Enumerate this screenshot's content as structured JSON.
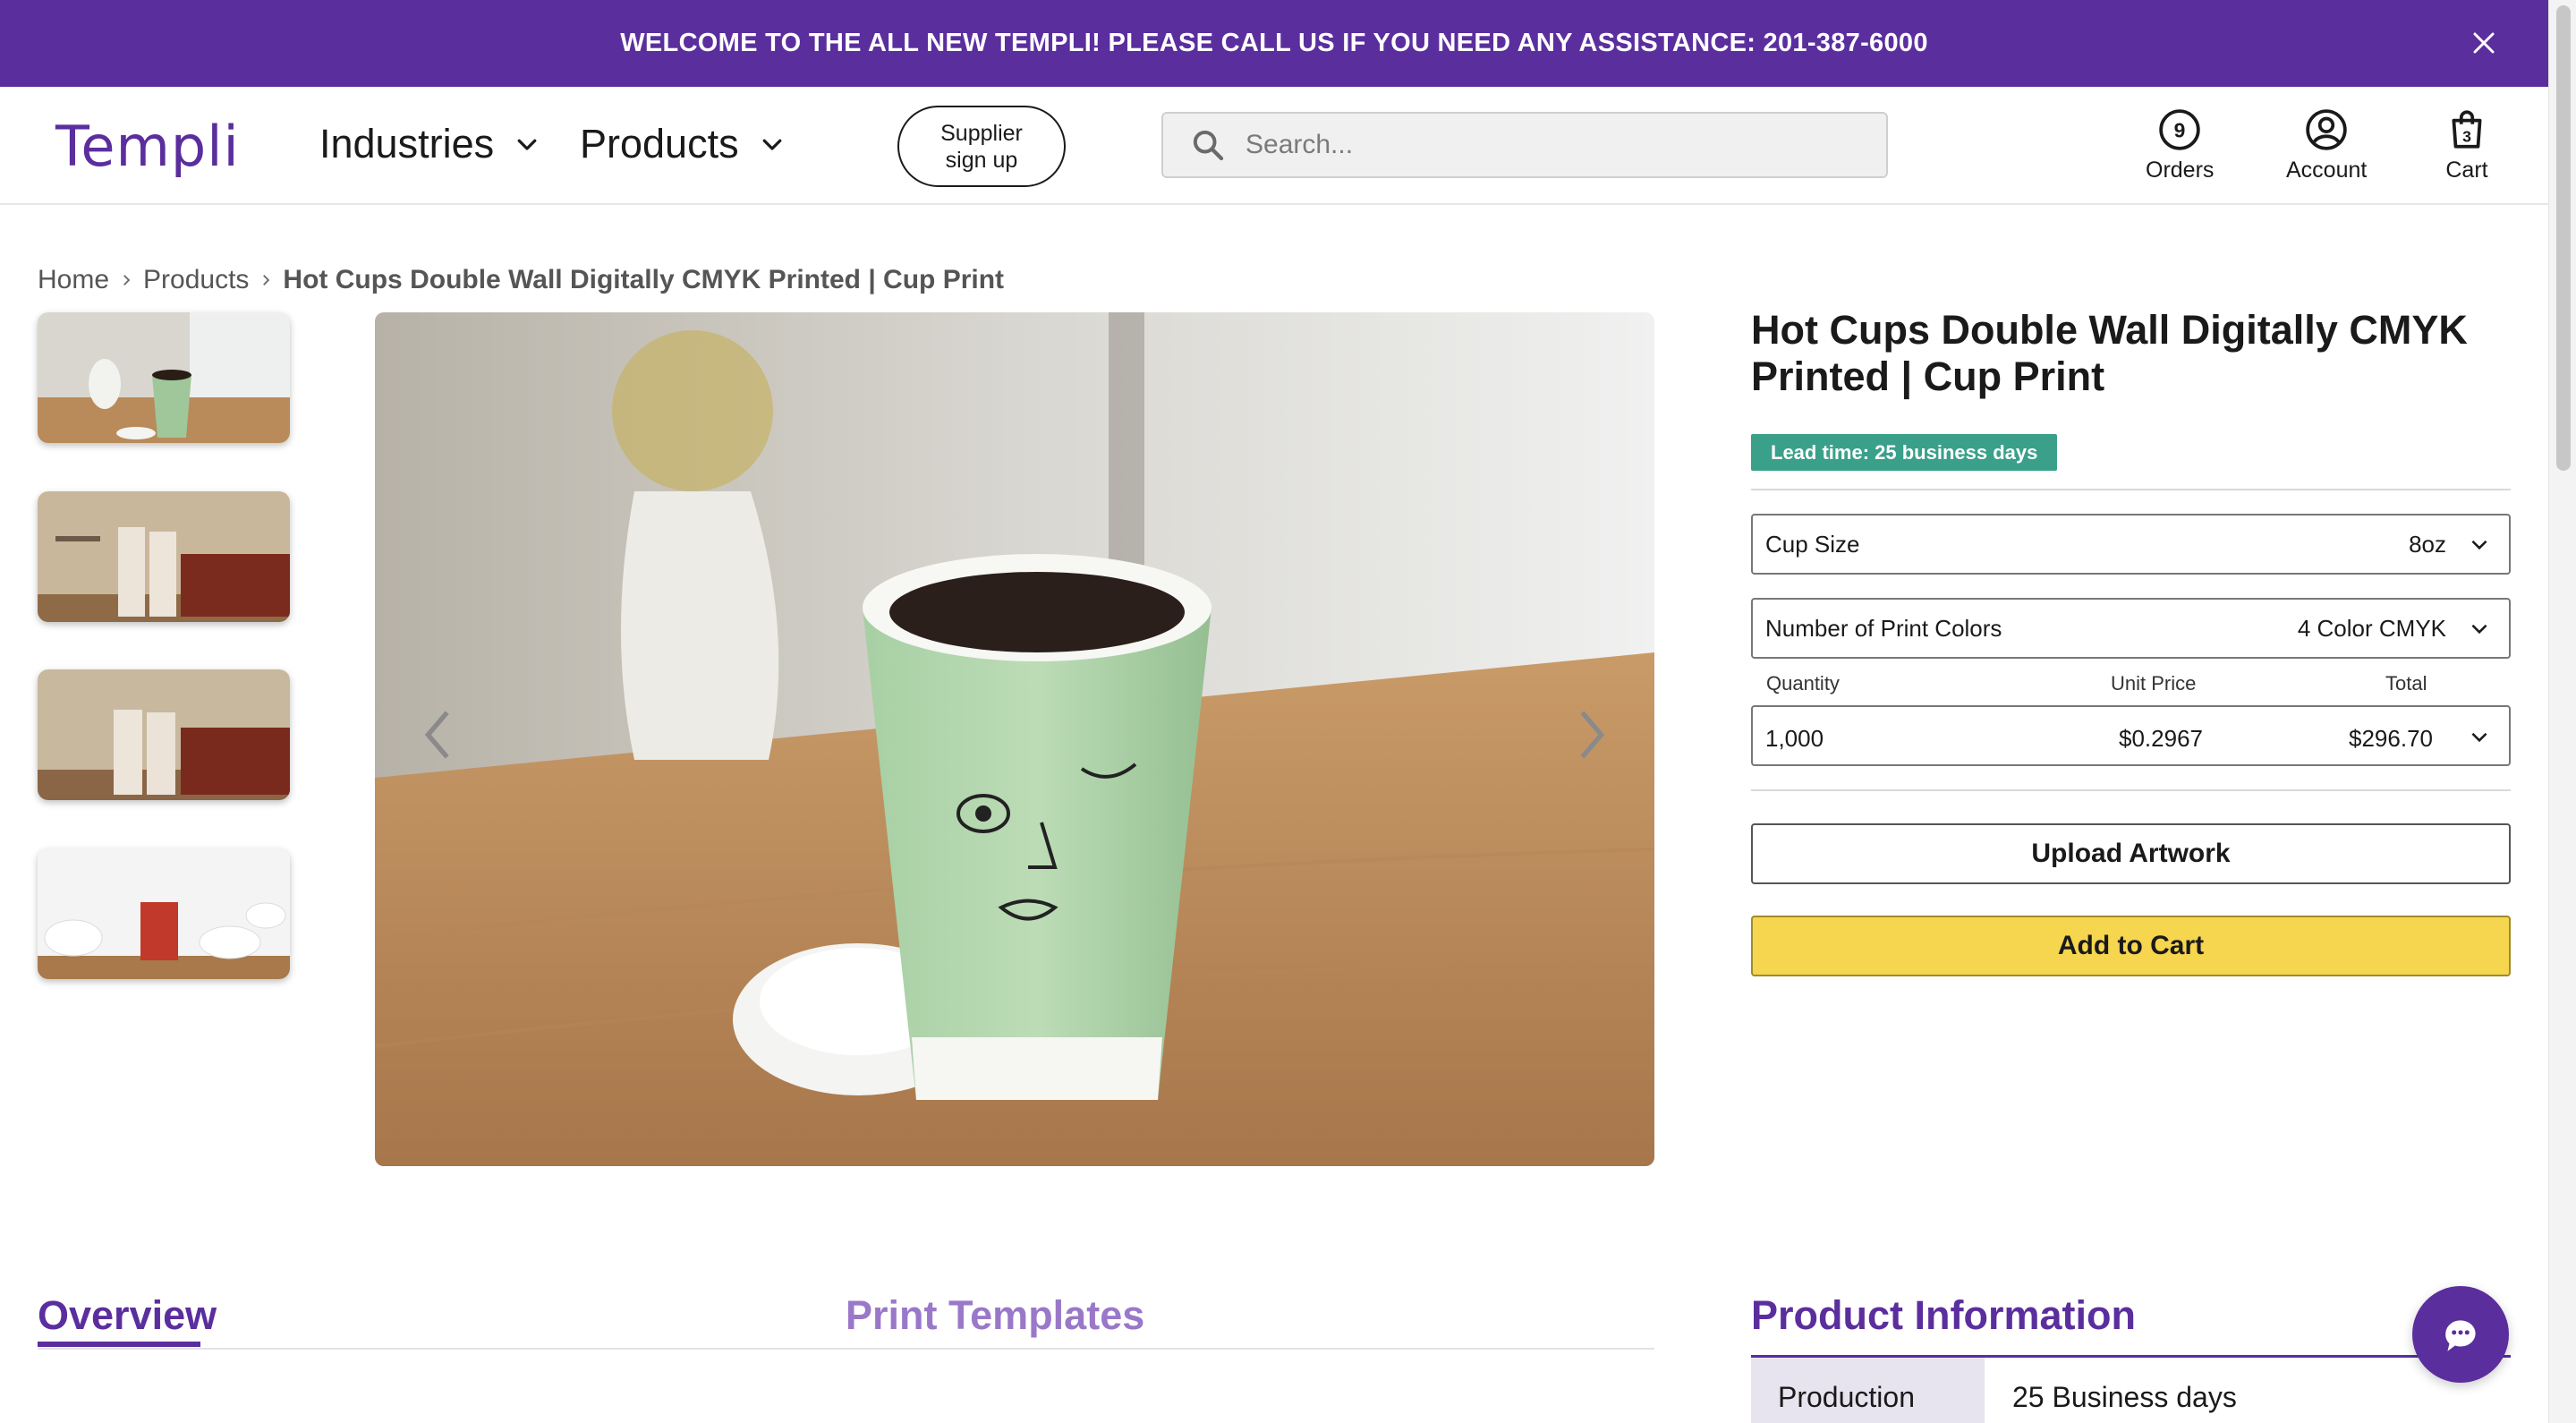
{
  "announcement": {
    "text": "WELCOME TO THE ALL NEW TEMPLI! PLEASE CALL US IF YOU NEED ANY ASSISTANCE: 201-387-6000",
    "close_icon": "close-icon",
    "bg_color": "#5b2e9e"
  },
  "header": {
    "logo": "Templi",
    "nav": [
      {
        "label": "Industries",
        "icon": "chevron-down-icon"
      },
      {
        "label": "Products",
        "icon": "chevron-down-icon"
      }
    ],
    "supplier_line1": "Supplier",
    "supplier_line2": "sign up",
    "search_placeholder": "Search...",
    "orders": {
      "label": "Orders",
      "count": "9"
    },
    "account": {
      "label": "Account"
    },
    "cart": {
      "label": "Cart",
      "count": "3"
    }
  },
  "breadcrumb": {
    "home": "Home",
    "products": "Products",
    "current": "Hot Cups Double Wall Digitally CMYK Printed | Cup Print"
  },
  "product": {
    "title": "Hot Cups Double Wall Digitally CMYK Printed | Cup Print",
    "lead_time": "Lead time: 25 business days",
    "cup_size": {
      "label": "Cup Size",
      "value": "8oz"
    },
    "print_colors": {
      "label": "Number of Print Colors",
      "value": "4 Color CMYK"
    },
    "quantity_table": {
      "headers": {
        "quantity": "Quantity",
        "unit_price": "Unit Price",
        "total": "Total"
      },
      "row": {
        "quantity": "1,000",
        "unit_price": "$0.2967",
        "total": "$296.70"
      }
    },
    "upload_label": "Upload Artwork",
    "add_to_cart_label": "Add to Cart"
  },
  "tabs": {
    "overview": "Overview",
    "print_templates": "Print Templates"
  },
  "product_information": {
    "title": "Product Information",
    "rows": [
      {
        "key": "Production",
        "value": "25 Business days"
      }
    ]
  },
  "colors": {
    "brand_purple": "#5b2e9e",
    "lead_green": "#3aa08a",
    "cart_yellow": "#f6d54f"
  }
}
